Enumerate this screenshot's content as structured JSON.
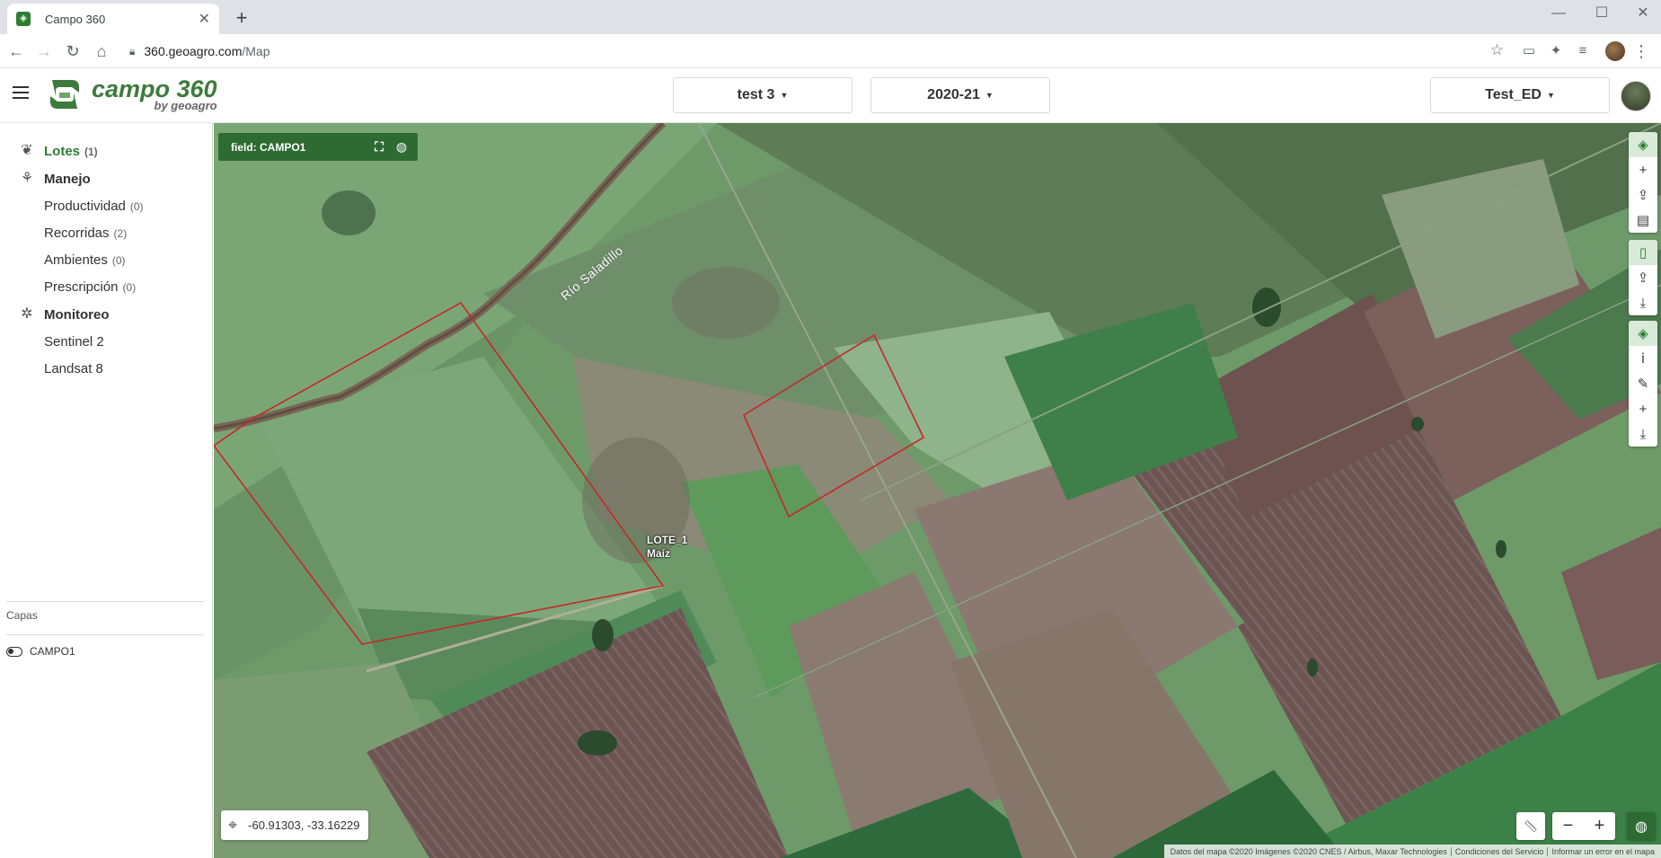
{
  "browser": {
    "tab_title": "Campo 360",
    "tab_close": "✕",
    "new_tab": "+",
    "url_host": "360.geoagro.com",
    "url_path": "/Map",
    "win_minimize": "—",
    "win_maximize": "☐",
    "win_close": "✕"
  },
  "header": {
    "logo_main": "campo 360",
    "logo_sub": "by geoagro",
    "dropdown_project": "test 3",
    "dropdown_season": "2020-21",
    "dropdown_user": "Test_ED",
    "brand_color": "#3d7a3d"
  },
  "sidebar": {
    "lotes": {
      "label": "Lotes",
      "count": "(1)"
    },
    "manejo": {
      "label": "Manejo"
    },
    "manejo_items": [
      {
        "label": "Productividad",
        "count": "(0)"
      },
      {
        "label": "Recorridas",
        "count": "(2)"
      },
      {
        "label": "Ambientes",
        "count": "(0)"
      },
      {
        "label": "Prescripción",
        "count": "(0)"
      }
    ],
    "monitoreo": {
      "label": "Monitoreo"
    },
    "monitoreo_items": [
      {
        "label": "Sentinel 2"
      },
      {
        "label": "Landsat 8"
      }
    ],
    "capas_title": "Capas",
    "layers": [
      {
        "label": "CAMPO1"
      }
    ]
  },
  "map": {
    "field_bar_label": "field: CAMPO1",
    "lote_name": "LOTE_1",
    "lote_crop": "Maíz",
    "river_label": "Río Saladillo",
    "coordinates": "-60.91303, -33.16229",
    "zoom_out": "−",
    "zoom_in": "+",
    "attribution": [
      "Datos del mapa ©2020 Imágenes ©2020 CNES / Airbus, Maxar Technologies",
      "Condiciones del Servicio",
      "Informar un error en el mapa"
    ],
    "boundary_color": "#c62828",
    "accent_color": "#2e6b33"
  }
}
